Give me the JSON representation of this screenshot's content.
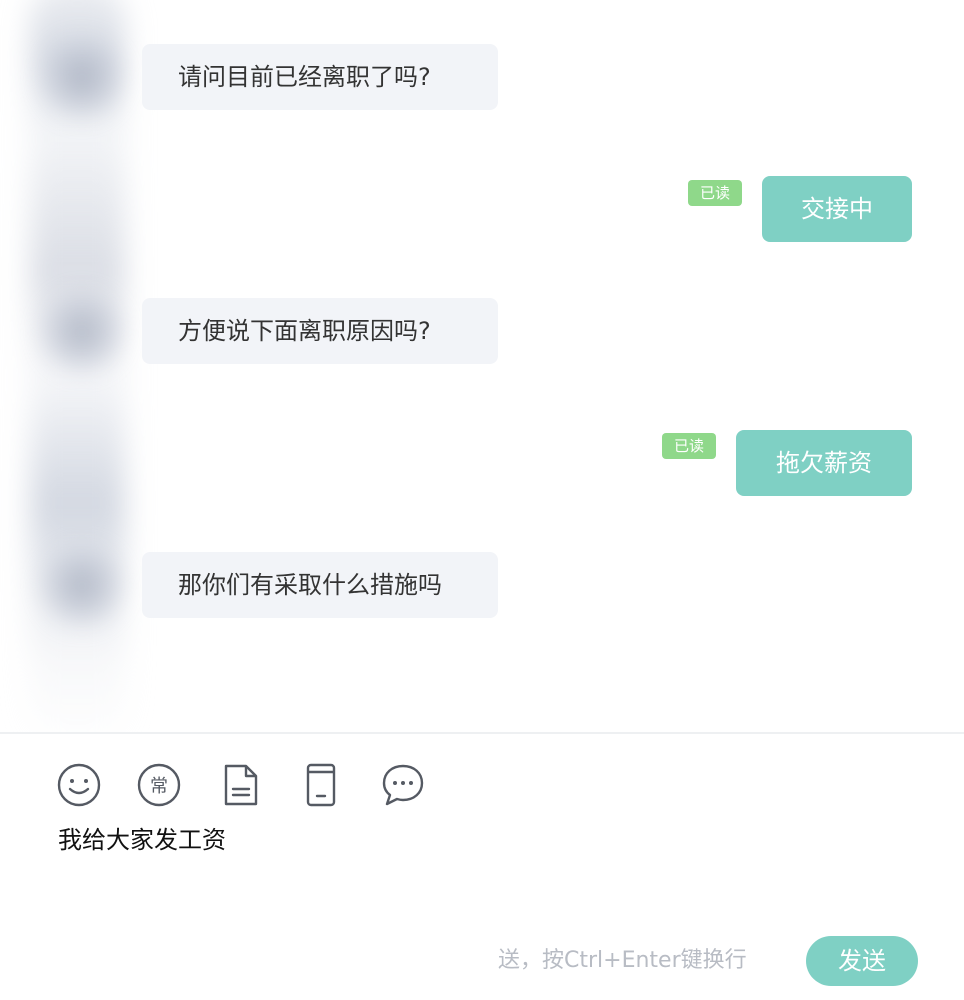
{
  "messages": [
    {
      "direction": "in",
      "text": "请问目前已经离职了吗?"
    },
    {
      "direction": "out",
      "text": "交接中",
      "status": "已读"
    },
    {
      "direction": "in",
      "text": "方便说下面离职原因吗?"
    },
    {
      "direction": "out",
      "text": "拖欠薪资",
      "status": "已读"
    },
    {
      "direction": "in",
      "text": "那你们有采取什么措施吗"
    }
  ],
  "toolbar": {
    "icons": [
      "emoji-icon",
      "common-phrases-icon",
      "file-icon",
      "phone-icon",
      "chat-bubble-icon"
    ],
    "common_label": "常"
  },
  "composer": {
    "draft_text": "我给大家发工资",
    "hint_text": "送，按Ctrl+Enter键换行",
    "send_label": "发送"
  },
  "colors": {
    "accent": "#7fd0c4",
    "read_badge": "#8fd88a",
    "incoming_bubble": "#f2f4f8"
  }
}
